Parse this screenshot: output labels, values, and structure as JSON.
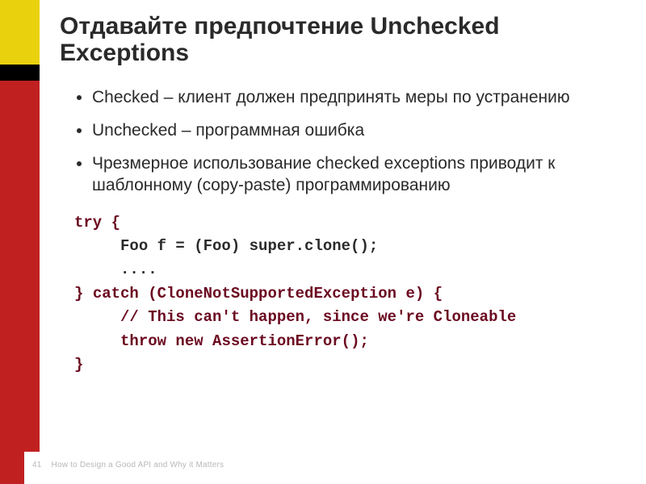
{
  "slide": {
    "title": "Отдавайте предпочтение Unchecked Exceptions",
    "bullets": [
      "Checked – клиент должен предпринять меры по устранению",
      "Unchecked – программная ошибка",
      "Чрезмерное использование checked exceptions приводит к шаблонному (copy-paste) программированию"
    ],
    "code": {
      "l1a": "try",
      "l1b": " {",
      "l2": "     Foo f = (Foo) super.clone();",
      "l3": "     ....",
      "l4a": "} ",
      "l4b": "catch",
      "l4c": " (CloneNotSupportedException e) {",
      "l5": "     // This can't happen, since we're Cloneable",
      "l6a": "     ",
      "l6b": "throw new",
      "l6c": " AssertionError();",
      "l7": "}"
    },
    "footer": {
      "page": "41",
      "caption": "How to Design a Good API and Why it Matters"
    },
    "colors": {
      "yellow": "#ead10e",
      "red": "#c12020",
      "keyword": "#6b0a20"
    }
  }
}
